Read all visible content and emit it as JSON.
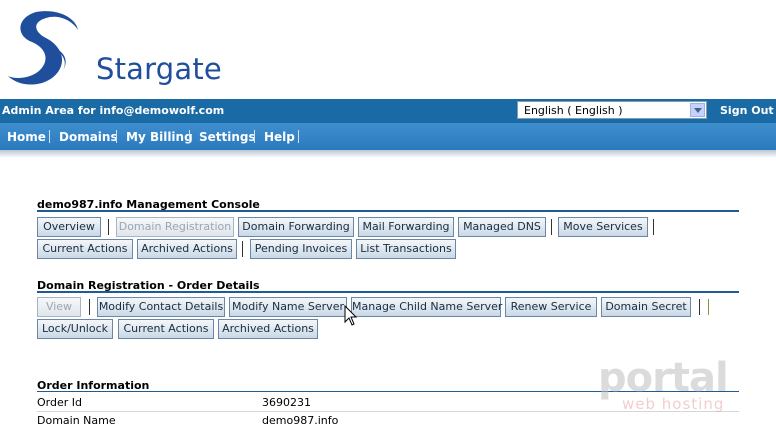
{
  "brand": {
    "name": "Stargate"
  },
  "admin_bar": {
    "admin_text": "Admin Area for info@demowolf.com",
    "language_selected": "English ( English )",
    "sign_out": "Sign Out"
  },
  "nav": [
    {
      "label": "Home"
    },
    {
      "label": "Domains"
    },
    {
      "label": "My Billing"
    },
    {
      "label": "Settings"
    },
    {
      "label": "Help"
    }
  ],
  "console": {
    "title": "demo987.info Management Console",
    "row1": [
      {
        "label": "Overview",
        "disabled": false
      },
      {
        "label": "Domain Registration",
        "disabled": true
      },
      {
        "label": "Domain Forwarding",
        "disabled": false
      },
      {
        "label": "Mail Forwarding",
        "disabled": false
      },
      {
        "label": "Managed DNS",
        "disabled": false
      },
      {
        "label": "Move Services",
        "disabled": false
      }
    ],
    "row2": [
      {
        "label": "Current Actions"
      },
      {
        "label": "Archived Actions"
      },
      {
        "label": "Pending Invoices"
      },
      {
        "label": "List Transactions"
      }
    ]
  },
  "order_details": {
    "title": "Domain Registration - Order Details",
    "row1": [
      {
        "label": "View",
        "disabled": true
      },
      {
        "label": "Modify Contact Details",
        "disabled": false
      },
      {
        "label": "Modify Name Server",
        "disabled": false
      },
      {
        "label": "Manage Child Name Server",
        "disabled": false
      },
      {
        "label": "Renew Service",
        "disabled": false
      },
      {
        "label": "Domain Secret",
        "disabled": false
      }
    ],
    "row2": [
      {
        "label": "Lock/Unlock"
      },
      {
        "label": "Current Actions"
      },
      {
        "label": "Archived Actions"
      }
    ]
  },
  "order_info": {
    "title": "Order Information",
    "rows": [
      {
        "label": "Order Id",
        "value": "3690231"
      },
      {
        "label": "Domain Name",
        "value": "demo987.info"
      }
    ]
  },
  "watermark": {
    "line1": "portal",
    "line2": "web hosting"
  },
  "colors": {
    "admin_bar": "#1a6aa6",
    "nav_bar": "#2a79be",
    "brand": "#1f4e9c"
  }
}
